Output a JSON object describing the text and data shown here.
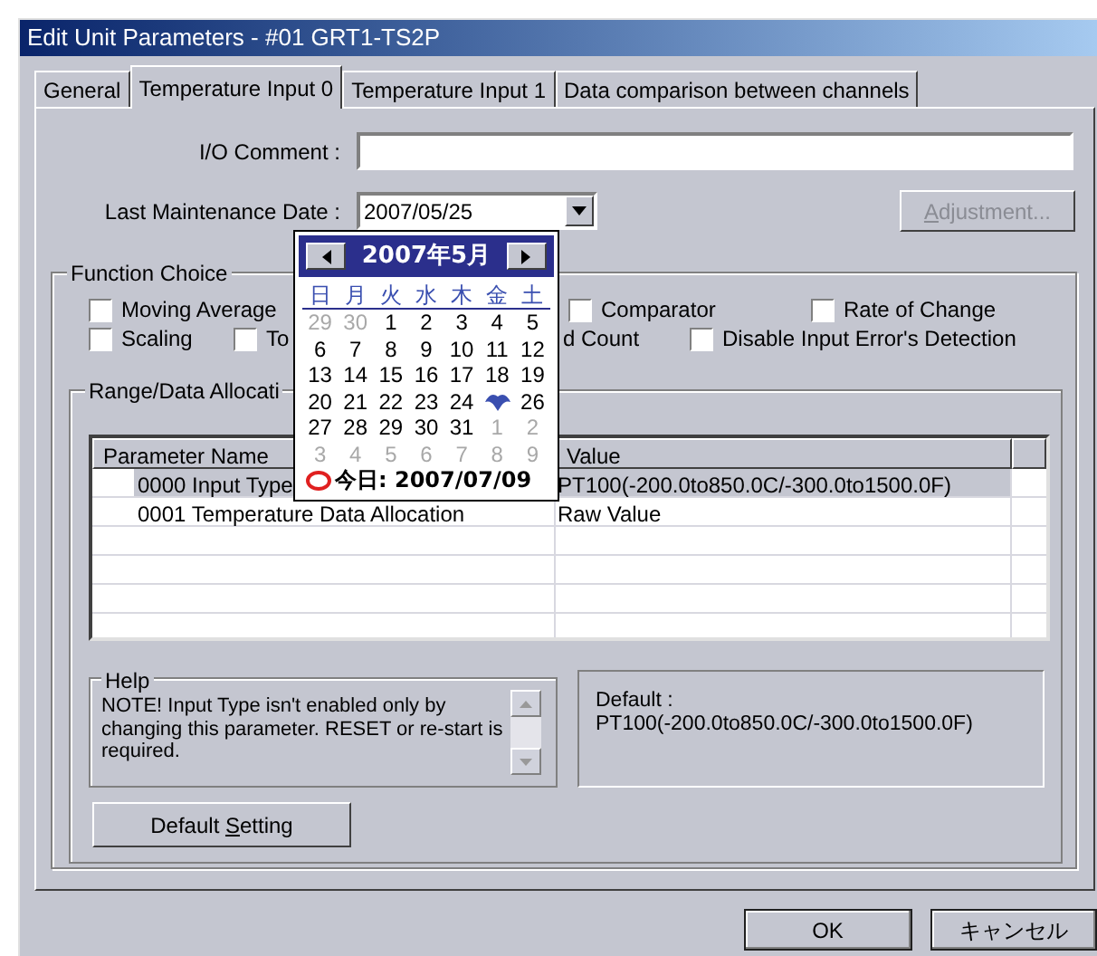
{
  "window": {
    "title": "Edit Unit Parameters - #01 GRT1-TS2P"
  },
  "tabs": [
    {
      "label": "General",
      "selected": false
    },
    {
      "label": "Temperature Input 0",
      "selected": true
    },
    {
      "label": "Temperature Input 1",
      "selected": false
    },
    {
      "label": "Data comparison between channels",
      "selected": false
    }
  ],
  "io_comment": {
    "label": "I/O Comment :"
  },
  "last_maintenance_date": {
    "label": "Last Maintenance Date :",
    "value": "2007/05/25"
  },
  "adjustment_button": {
    "label": "Adjustment...",
    "disabled": true
  },
  "function_choice": {
    "title": "Function Choice",
    "options": [
      {
        "kind": "checkbox",
        "label": "Moving Average",
        "checked": false
      },
      {
        "kind": "checkbox",
        "label": "Comparator",
        "checked": false
      },
      {
        "kind": "checkbox",
        "label": "Rate of Change",
        "checked": false
      },
      {
        "kind": "checkbox",
        "label": "Scaling",
        "checked": false
      },
      {
        "kind": "checkbox",
        "label": "To",
        "checked": false
      },
      {
        "kind": "text",
        "label": "d Count"
      },
      {
        "kind": "checkbox",
        "label": "Disable Input Error's Detection",
        "checked": false
      }
    ]
  },
  "range_group": {
    "title": "Range/Data Allocati",
    "table": {
      "columns": [
        "Parameter Name",
        "Value"
      ],
      "rows": [
        {
          "cells": [
            "0000 Input Type",
            "PT100(-200.0to850.0C/-300.0to1500.0F)"
          ],
          "selected": true
        },
        {
          "cells": [
            "0001 Temperature Data Allocation",
            "Raw Value"
          ],
          "selected": false
        }
      ]
    }
  },
  "help": {
    "title": "Help",
    "text": "NOTE! Input Type isn't enabled only by changing this parameter. RESET or re-start is required."
  },
  "default_info": "Default : PT100(-200.0to850.0C/-300.0to1500.0F)",
  "default_setting_button": {
    "label": "Default Setting"
  },
  "buttons": [
    {
      "label": "OK"
    },
    {
      "label": "キャンセル"
    }
  ],
  "calendar": {
    "month": "2007年5月",
    "weekdays": [
      "日",
      "月",
      "火",
      "水",
      "木",
      "金",
      "土"
    ],
    "days": [
      {
        "day": "29",
        "muted": true
      },
      {
        "day": "30",
        "muted": true
      },
      {
        "day": "1"
      },
      {
        "day": "2"
      },
      {
        "day": "3"
      },
      {
        "day": "4"
      },
      {
        "day": "5"
      },
      {
        "day": "6"
      },
      {
        "day": "7"
      },
      {
        "day": "8"
      },
      {
        "day": "9"
      },
      {
        "day": "10"
      },
      {
        "day": "11"
      },
      {
        "day": "12"
      },
      {
        "day": "13"
      },
      {
        "day": "14"
      },
      {
        "day": "15"
      },
      {
        "day": "16"
      },
      {
        "day": "17"
      },
      {
        "day": "18"
      },
      {
        "day": "19"
      },
      {
        "day": "20"
      },
      {
        "day": "21"
      },
      {
        "day": "22"
      },
      {
        "day": "23"
      },
      {
        "day": "24"
      },
      {
        "selected": true
      },
      {
        "day": "26"
      },
      {
        "day": "27"
      },
      {
        "day": "28"
      },
      {
        "day": "29"
      },
      {
        "day": "30"
      },
      {
        "day": "31"
      },
      {
        "day": "1",
        "muted": true
      },
      {
        "day": "2",
        "muted": true
      },
      {
        "day": "3",
        "muted": true
      },
      {
        "day": "4",
        "muted": true
      },
      {
        "day": "5",
        "muted": true
      },
      {
        "day": "6",
        "muted": true
      },
      {
        "day": "7",
        "muted": true
      },
      {
        "day": "8",
        "muted": true
      },
      {
        "day": "9",
        "muted": true
      }
    ],
    "today": "今日: 2007/07/09"
  }
}
